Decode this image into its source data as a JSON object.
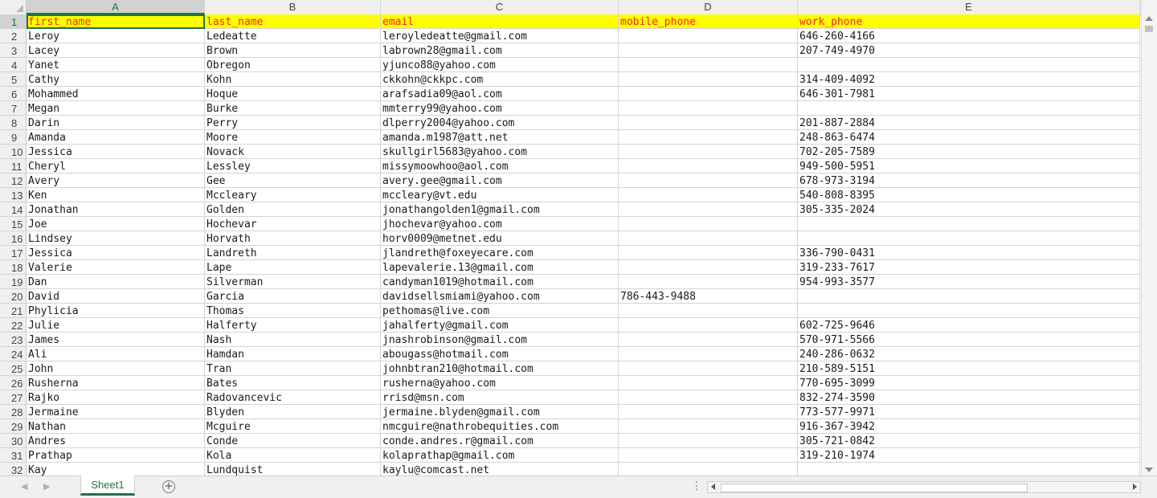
{
  "columns": [
    "A",
    "B",
    "C",
    "D",
    "E"
  ],
  "rows": [
    {
      "num": "1",
      "cells": [
        "first_name",
        "last_name",
        "email",
        "mobile_phone",
        "work_phone"
      ]
    },
    {
      "num": "2",
      "cells": [
        "Leroy",
        "Ledeatte",
        "leroyledeatte@gmail.com",
        "",
        "646-260-4166"
      ]
    },
    {
      "num": "3",
      "cells": [
        "Lacey",
        "Brown",
        "labrown28@gmail.com",
        "",
        "207-749-4970"
      ]
    },
    {
      "num": "4",
      "cells": [
        "Yanet",
        "Obregon",
        "yjunco88@yahoo.com",
        "",
        ""
      ]
    },
    {
      "num": "5",
      "cells": [
        "Cathy",
        "Kohn",
        "ckkohn@ckkpc.com",
        "",
        "314-409-4092"
      ]
    },
    {
      "num": "6",
      "cells": [
        "Mohammed",
        "Hoque",
        "arafsadia09@aol.com",
        "",
        "646-301-7981"
      ]
    },
    {
      "num": "7",
      "cells": [
        "Megan",
        "Burke",
        "mmterry99@yahoo.com",
        "",
        ""
      ]
    },
    {
      "num": "8",
      "cells": [
        "Darin",
        "Perry",
        "dlperry2004@yahoo.com",
        "",
        "201-887-2884"
      ]
    },
    {
      "num": "9",
      "cells": [
        "Amanda",
        "Moore",
        "amanda.m1987@att.net",
        "",
        "248-863-6474"
      ]
    },
    {
      "num": "10",
      "cells": [
        "Jessica",
        "Novack",
        "skullgirl5683@yahoo.com",
        "",
        "702-205-7589"
      ]
    },
    {
      "num": "11",
      "cells": [
        "Cheryl",
        "Lessley",
        "missymoowhoo@aol.com",
        "",
        "949-500-5951"
      ]
    },
    {
      "num": "12",
      "cells": [
        "Avery",
        "Gee",
        "avery.gee@gmail.com",
        "",
        "678-973-3194"
      ]
    },
    {
      "num": "13",
      "cells": [
        "Ken",
        "Mccleary",
        "mccleary@vt.edu",
        "",
        "540-808-8395"
      ]
    },
    {
      "num": "14",
      "cells": [
        "Jonathan",
        "Golden",
        "jonathangolden1@gmail.com",
        "",
        "305-335-2024"
      ]
    },
    {
      "num": "15",
      "cells": [
        "Joe",
        "Hochevar",
        "jhochevar@yahoo.com",
        "",
        ""
      ]
    },
    {
      "num": "16",
      "cells": [
        "Lindsey",
        "Horvath",
        "horv0009@metnet.edu",
        "",
        ""
      ]
    },
    {
      "num": "17",
      "cells": [
        "Jessica",
        "Landreth",
        "jlandreth@foxeyecare.com",
        "",
        "336-790-0431"
      ]
    },
    {
      "num": "18",
      "cells": [
        "Valerie",
        "Lape",
        "lapevalerie.13@gmail.com",
        "",
        "319-233-7617"
      ]
    },
    {
      "num": "19",
      "cells": [
        "Dan",
        "Silverman",
        "candyman1019@hotmail.com",
        "",
        "954-993-3577"
      ]
    },
    {
      "num": "20",
      "cells": [
        "David",
        "Garcia",
        "davidsellsmiami@yahoo.com",
        "786-443-9488",
        ""
      ]
    },
    {
      "num": "21",
      "cells": [
        "Phylicia",
        "Thomas",
        "pethomas@live.com",
        "",
        ""
      ]
    },
    {
      "num": "22",
      "cells": [
        "Julie",
        "Halferty",
        "jahalferty@gmail.com",
        "",
        "602-725-9646"
      ]
    },
    {
      "num": "23",
      "cells": [
        "James",
        "Nash",
        "jnashrobinson@gmail.com",
        "",
        "570-971-5566"
      ]
    },
    {
      "num": "24",
      "cells": [
        "Ali",
        "Hamdan",
        "abougass@hotmail.com",
        "",
        "240-286-0632"
      ]
    },
    {
      "num": "25",
      "cells": [
        "John",
        "Tran",
        "johnbtran210@hotmail.com",
        "",
        "210-589-5151"
      ]
    },
    {
      "num": "26",
      "cells": [
        "Rusherna",
        "Bates",
        "rusherna@yahoo.com",
        "",
        "770-695-3099"
      ]
    },
    {
      "num": "27",
      "cells": [
        "Rajko",
        "Radovancevic",
        "rrisd@msn.com",
        "",
        "832-274-3590"
      ]
    },
    {
      "num": "28",
      "cells": [
        "Jermaine",
        "Blyden",
        "jermaine.blyden@gmail.com",
        "",
        "773-577-9971"
      ]
    },
    {
      "num": "29",
      "cells": [
        "Nathan",
        "Mcguire",
        "nmcguire@nathrobequities.com",
        "",
        "916-367-3942"
      ]
    },
    {
      "num": "30",
      "cells": [
        "Andres",
        "Conde",
        "conde.andres.r@gmail.com",
        "",
        "305-721-0842"
      ]
    },
    {
      "num": "31",
      "cells": [
        "Prathap",
        "Kola",
        "kolaprathap@gmail.com",
        "",
        "319-210-1974"
      ]
    },
    {
      "num": "32",
      "cells": [
        "Kay",
        "Lundquist",
        "kaylu@comcast.net",
        "",
        ""
      ]
    }
  ],
  "sheet_tab": "Sheet1",
  "add_sheet_symbol": "+",
  "more_symbol": "⋮",
  "colors": {
    "header_fill": "#ffff00",
    "header_text": "#ff2020",
    "accent": "#217346"
  }
}
